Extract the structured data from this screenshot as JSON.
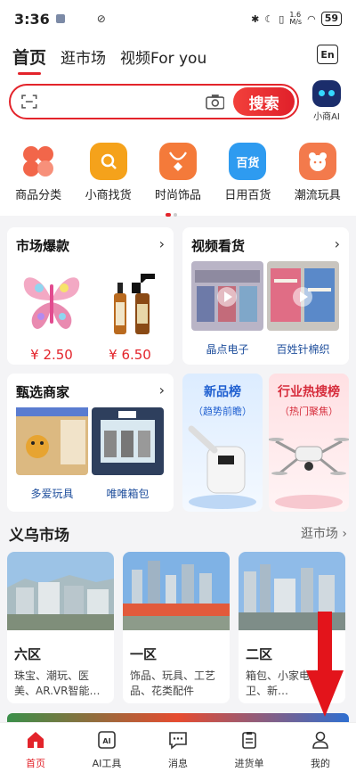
{
  "status": {
    "time": "3:36",
    "speed": "1.6\nM/s",
    "battery": "59"
  },
  "header": {
    "tabs": [
      "首页",
      "逛市场",
      "视频For you"
    ],
    "lang_button": "En",
    "search_button": "搜索",
    "search_placeholder": "",
    "ai_label": "小商AI"
  },
  "categories": [
    {
      "label": "商品分类",
      "color": "#f2664a"
    },
    {
      "label": "小商找货",
      "color": "#f5a21b"
    },
    {
      "label": "时尚饰品",
      "color": "#f47a3a"
    },
    {
      "label": "日用百货",
      "color": "#2e9bf0"
    },
    {
      "label": "潮流玩具",
      "color": "#f37a4c"
    }
  ],
  "hot": {
    "title": "市场爆款",
    "items": [
      {
        "price": "¥ 2.50"
      },
      {
        "price": "¥ 6.50"
      }
    ]
  },
  "video": {
    "title": "视频看货",
    "items": [
      {
        "caption": "晶点电子"
      },
      {
        "caption": "百姓针棉织"
      }
    ]
  },
  "merchants": {
    "title": "甄选商家",
    "items": [
      {
        "caption": "多爱玩具"
      },
      {
        "caption": "唯唯箱包"
      }
    ]
  },
  "newlist": {
    "title": "新品榜",
    "subtitle": "趋势前瞻"
  },
  "hotsearch": {
    "title": "行业热搜榜",
    "subtitle": "热门聚焦"
  },
  "yiwu": {
    "title": "义乌市场",
    "more": "逛市场",
    "markets": [
      {
        "name": "六区",
        "desc": "珠宝、潮玩、医美、AR.VR智能…"
      },
      {
        "name": "一区",
        "desc": "饰品、玩具、工艺品、花类配件"
      },
      {
        "name": "二区",
        "desc": "箱包、小家电金厨卫、新…"
      }
    ]
  },
  "tabbar": [
    "首页",
    "AI工具",
    "消息",
    "进货单",
    "我的"
  ]
}
